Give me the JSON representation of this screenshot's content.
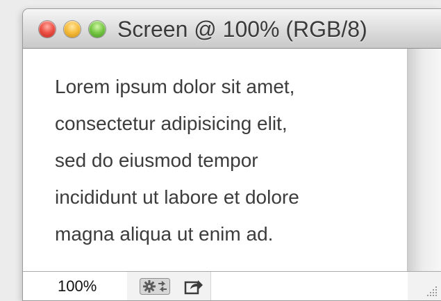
{
  "window": {
    "title": "Screen @ 100% (RGB/8)",
    "traffic_lights": {
      "close": "#ee5146",
      "minimize": "#f7bd3d",
      "zoom": "#79c947"
    }
  },
  "document": {
    "lines": [
      "Lorem ipsum dolor sit amet,",
      "consectetur adipisicing elit,",
      "sed do eiusmod tempor",
      "incididunt ut labore et dolore",
      "magna aliqua ut enim ad."
    ]
  },
  "statusbar": {
    "zoom_value": "100%",
    "icons": [
      "gpu-settings-icon",
      "share-icon"
    ]
  }
}
